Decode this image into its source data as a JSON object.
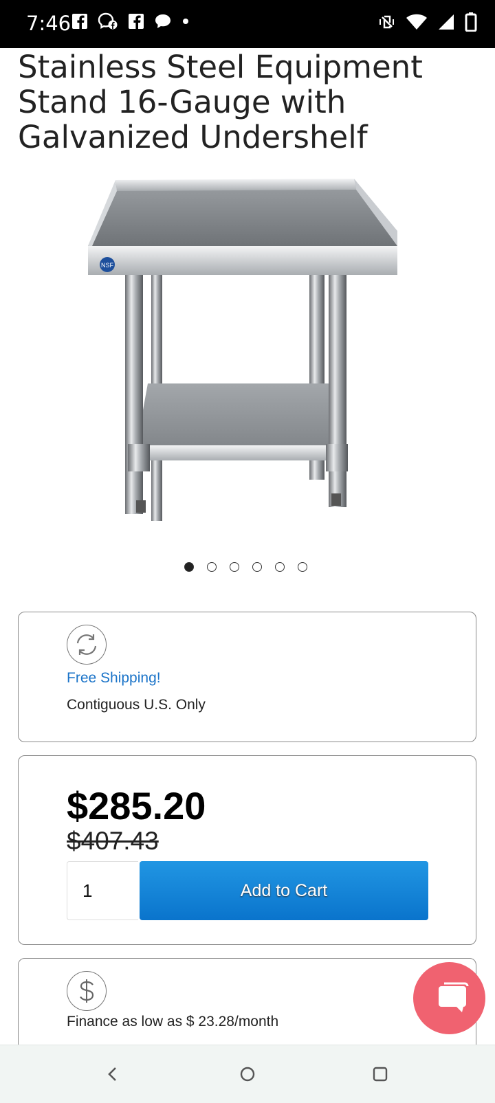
{
  "status_bar": {
    "time": "7:46",
    "left_icons": [
      "facebook-icon",
      "messenger-icon",
      "facebook-icon",
      "chat-bubble-icon",
      "notification-dot-icon"
    ],
    "right_icons": [
      "vibrate-off-icon",
      "wifi-icon",
      "signal-icon",
      "battery-icon"
    ]
  },
  "product": {
    "title": "Stainless Steel Equipment Stand 16-Gauge with Galvanized Undershelf",
    "image_icon": "equipment-stand-image",
    "carousel": {
      "count": 6,
      "active_index": 0
    }
  },
  "shipping": {
    "icon": "refresh-icon",
    "title": "Free Shipping!",
    "subtitle": "Contiguous U.S. Only"
  },
  "pricing": {
    "price": "$285.20",
    "original_price": "$407.43",
    "quantity": "1",
    "add_to_cart_label": "Add to Cart"
  },
  "finance": {
    "icon": "dollar-icon",
    "text": "Finance as low as $ 23.28/month"
  },
  "chat": {
    "icon": "chat-icon"
  },
  "colors": {
    "accent_blue": "#1a73c8",
    "button_blue": "#0a74cc",
    "chat_pink": "#f06270"
  },
  "nav_bar": {
    "buttons": [
      "back-icon",
      "home-icon",
      "recents-icon"
    ]
  }
}
